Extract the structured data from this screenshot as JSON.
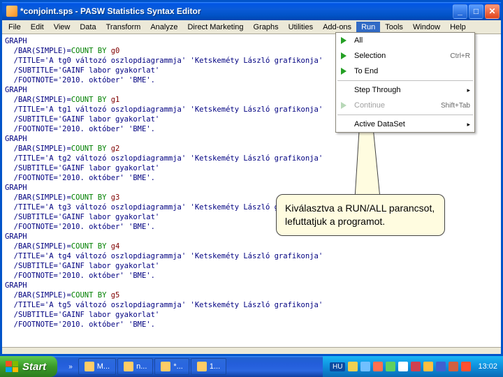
{
  "window": {
    "title": "*conjoint.sps - PASW Statistics Syntax Editor"
  },
  "menu": {
    "items": [
      "File",
      "Edit",
      "View",
      "Data",
      "Transform",
      "Analyze",
      "Direct Marketing",
      "Graphs",
      "Utilities",
      "Add-ons",
      "Run",
      "Tools",
      "Window",
      "Help"
    ],
    "open_index": 10
  },
  "run_menu": {
    "all": "All",
    "selection": "Selection",
    "selection_shortcut": "Ctrl+R",
    "to_end": "To End",
    "step_through": "Step Through",
    "continue": "Continue",
    "continue_shortcut": "Shift+Tab",
    "active_dataset": "Active DataSet"
  },
  "syntax": {
    "blocks": [
      {
        "var": "g0",
        "tg": "tg0"
      },
      {
        "var": "g1",
        "tg": "tg1"
      },
      {
        "var": "g2",
        "tg": "tg2"
      },
      {
        "var": "g3",
        "tg": "tg3"
      },
      {
        "var": "g4",
        "tg": "tg4"
      },
      {
        "var": "g5",
        "tg": "tg5"
      }
    ],
    "graph": "GRAPH",
    "bar_prefix": "  /BAR(SIMPLE)=",
    "count_by": "COUNT BY ",
    "title_prefix": "  /TITLE='A ",
    "title_mid": " változó oszlopdiagrammja' 'Ketskeméty László grafikonja'",
    "subtitle": "  /SUBTITLE='GAINF labor gyakorlat'",
    "footnote": "  /FOOTNOTE='2010. október' 'BME'."
  },
  "callout": {
    "text": "Kiválasztva a RUN/ALL parancsot, lefuttatjuk a programot."
  },
  "taskbar": {
    "start": "Start",
    "buttons": [
      "M",
      "n",
      "*",
      "1"
    ],
    "lang": "HU",
    "clock": "13:02"
  },
  "tray_icon_colors": [
    "#f0d050",
    "#70c0ff",
    "#ff7050",
    "#60d060",
    "#ffffff",
    "#d04050",
    "#ffc040",
    "#4060d0",
    "#d06040",
    "#ff5030"
  ]
}
